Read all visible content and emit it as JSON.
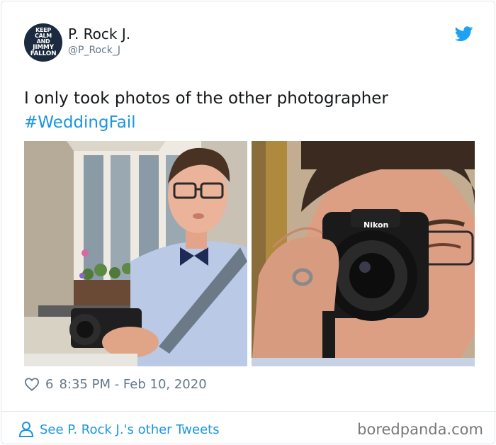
{
  "author": {
    "display_name": "P. Rock J.",
    "handle": "@P_Rock_J",
    "avatar_text": [
      "KEEP",
      "CALM",
      "AND",
      "JIMMY",
      "FALLON"
    ]
  },
  "tweet": {
    "text": "I only took photos of the other photographer",
    "hashtag": "#WeddingFail"
  },
  "media": {
    "camera_brand": "Nikon"
  },
  "meta": {
    "likes": "6",
    "timestamp": "8:35 PM - Feb 10, 2020"
  },
  "footer": {
    "other_tweets_link": "See P. Rock J.'s other Tweets",
    "watermark": "boredpanda.com"
  },
  "colors": {
    "link": "#1b95e0",
    "text": "#14171a",
    "muted": "#657786",
    "border": "#e1e8ed",
    "twitter_blue": "#1da1f2"
  }
}
